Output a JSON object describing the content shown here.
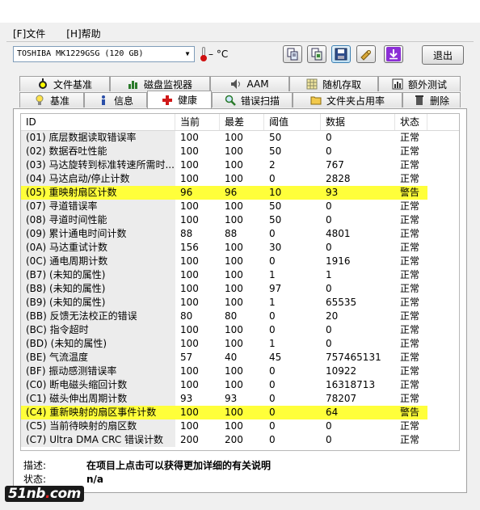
{
  "menu": {
    "file": "[F]文件",
    "help": "[H]帮助"
  },
  "drive": {
    "selected": "TOSHIBA MK1229GSG (120 GB)"
  },
  "temperature": {
    "value": "– °C"
  },
  "toolbar": {
    "icons": [
      "copy-icon",
      "copy-screenshot-icon",
      "save-icon",
      "options-icon",
      "download-icon"
    ],
    "exit_label": "退出"
  },
  "tabs_top": [
    {
      "label": "文件基准",
      "icon": "stopwatch-icon"
    },
    {
      "label": "磁盘监视器",
      "icon": "bar-chart-icon"
    },
    {
      "label": "AAM",
      "icon": "speaker-icon"
    },
    {
      "label": "随机存取",
      "icon": "grid-icon"
    },
    {
      "label": "额外测试",
      "icon": "chart-window-icon"
    }
  ],
  "tabs_bottom": [
    {
      "label": "基准",
      "icon": "lightbulb-icon"
    },
    {
      "label": "信息",
      "icon": "info-icon"
    },
    {
      "label": "健康",
      "icon": "red-cross-icon",
      "selected": true
    },
    {
      "label": "错误扫描",
      "icon": "magnifier-icon"
    },
    {
      "label": "文件夹占用率",
      "icon": "folder-icon"
    },
    {
      "label": "删除",
      "icon": "trash-icon"
    }
  ],
  "table": {
    "headers": {
      "id": "ID",
      "current": "当前",
      "worst": "最差",
      "threshold": "阈值",
      "data": "数据",
      "status": "状态"
    },
    "rows": [
      {
        "id": "(01) 底层数据读取错误率",
        "current": "100",
        "worst": "100",
        "threshold": "50",
        "data": "0",
        "status": "正常",
        "warn": false
      },
      {
        "id": "(02) 数据吞吐性能",
        "current": "100",
        "worst": "100",
        "threshold": "50",
        "data": "0",
        "status": "正常",
        "warn": false
      },
      {
        "id": "(03) 马达旋转到标准转速所需时...",
        "current": "100",
        "worst": "100",
        "threshold": "2",
        "data": "767",
        "status": "正常",
        "warn": false
      },
      {
        "id": "(04) 马达启动/停止计数",
        "current": "100",
        "worst": "100",
        "threshold": "0",
        "data": "2828",
        "status": "正常",
        "warn": false
      },
      {
        "id": "(05) 重映射扇区计数",
        "current": "96",
        "worst": "96",
        "threshold": "10",
        "data": "93",
        "status": "警告",
        "warn": true
      },
      {
        "id": "(07) 寻道错误率",
        "current": "100",
        "worst": "100",
        "threshold": "50",
        "data": "0",
        "status": "正常",
        "warn": false
      },
      {
        "id": "(08) 寻道时间性能",
        "current": "100",
        "worst": "100",
        "threshold": "50",
        "data": "0",
        "status": "正常",
        "warn": false
      },
      {
        "id": "(09) 累计通电时间计数",
        "current": "88",
        "worst": "88",
        "threshold": "0",
        "data": "4801",
        "status": "正常",
        "warn": false
      },
      {
        "id": "(0A) 马达重试计数",
        "current": "156",
        "worst": "100",
        "threshold": "30",
        "data": "0",
        "status": "正常",
        "warn": false
      },
      {
        "id": "(0C) 通电周期计数",
        "current": "100",
        "worst": "100",
        "threshold": "0",
        "data": "1916",
        "status": "正常",
        "warn": false
      },
      {
        "id": "(B7) (未知的属性)",
        "current": "100",
        "worst": "100",
        "threshold": "1",
        "data": "1",
        "status": "正常",
        "warn": false
      },
      {
        "id": "(B8) (未知的属性)",
        "current": "100",
        "worst": "100",
        "threshold": "97",
        "data": "0",
        "status": "正常",
        "warn": false
      },
      {
        "id": "(B9) (未知的属性)",
        "current": "100",
        "worst": "100",
        "threshold": "1",
        "data": "65535",
        "status": "正常",
        "warn": false
      },
      {
        "id": "(BB) 反馈无法校正的错误",
        "current": "80",
        "worst": "80",
        "threshold": "0",
        "data": "20",
        "status": "正常",
        "warn": false
      },
      {
        "id": "(BC) 指令超时",
        "current": "100",
        "worst": "100",
        "threshold": "0",
        "data": "0",
        "status": "正常",
        "warn": false
      },
      {
        "id": "(BD) (未知的属性)",
        "current": "100",
        "worst": "100",
        "threshold": "1",
        "data": "0",
        "status": "正常",
        "warn": false
      },
      {
        "id": "(BE) 气流温度",
        "current": "57",
        "worst": "40",
        "threshold": "45",
        "data": "757465131",
        "status": "正常",
        "warn": false
      },
      {
        "id": "(BF) 振动感测错误率",
        "current": "100",
        "worst": "100",
        "threshold": "0",
        "data": "10922",
        "status": "正常",
        "warn": false
      },
      {
        "id": "(C0) 断电磁头缩回计数",
        "current": "100",
        "worst": "100",
        "threshold": "0",
        "data": "16318713",
        "status": "正常",
        "warn": false
      },
      {
        "id": "(C1) 磁头伸出周期计数",
        "current": "93",
        "worst": "93",
        "threshold": "0",
        "data": "78207",
        "status": "正常",
        "warn": false
      },
      {
        "id": "(C4) 重新映射的扇区事件计数",
        "current": "100",
        "worst": "100",
        "threshold": "0",
        "data": "64",
        "status": "警告",
        "warn": true
      },
      {
        "id": "(C5) 当前待映射的扇区数",
        "current": "100",
        "worst": "100",
        "threshold": "0",
        "data": "0",
        "status": "正常",
        "warn": false
      },
      {
        "id": "(C7) Ultra DMA CRC 错误计数",
        "current": "200",
        "worst": "200",
        "threshold": "0",
        "data": "0",
        "status": "正常",
        "warn": false
      }
    ]
  },
  "description": {
    "label": "描述:",
    "value": "在项目上点击可以获得更加详细的有关说明"
  },
  "state": {
    "label": "状态:",
    "value": "n/a"
  },
  "watermark": {
    "text_main": "51nb",
    "text_dot": ".",
    "text_tail": "com"
  },
  "colors": {
    "warn_row": "#ffff3a",
    "thermometer": "#d01010",
    "download_button": "#8c2fd6"
  }
}
